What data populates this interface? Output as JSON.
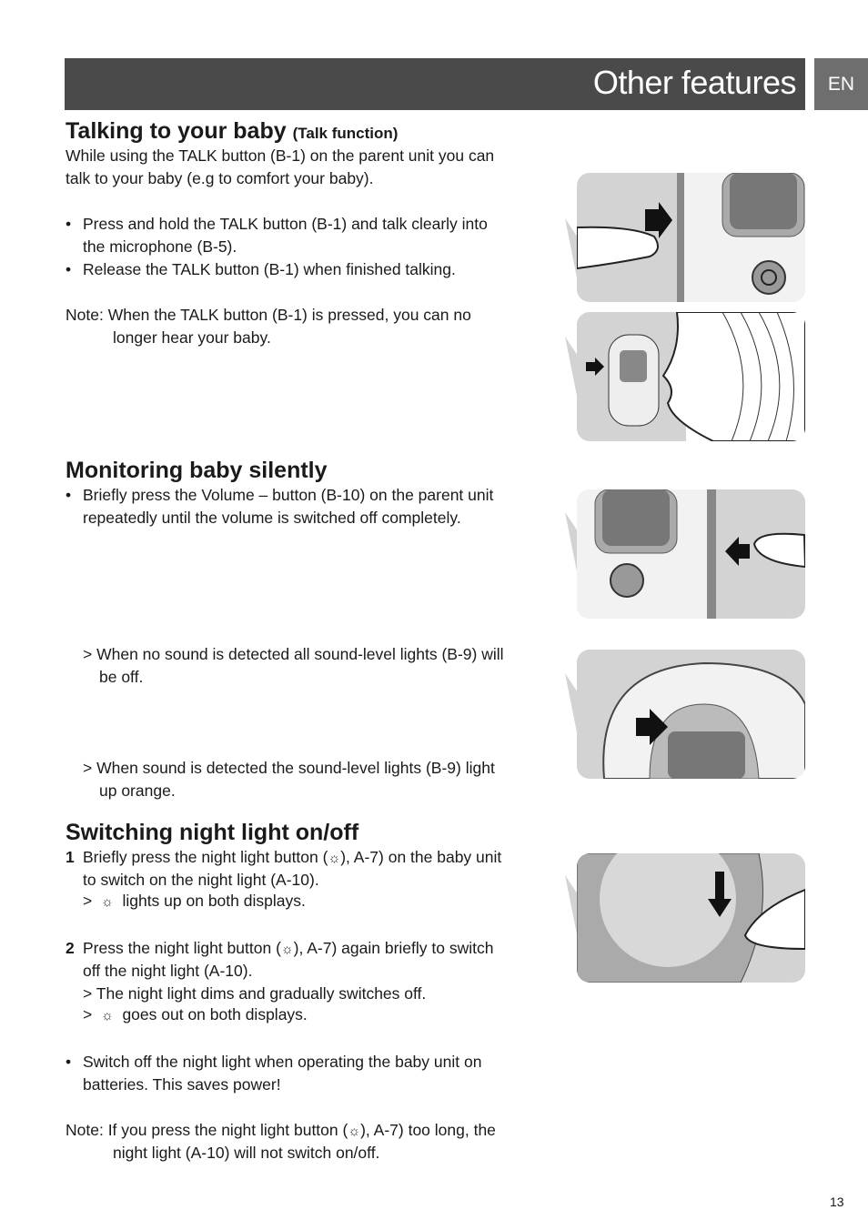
{
  "header": {
    "title": "Other features",
    "lang": "EN"
  },
  "talk": {
    "heading": "Talking to your baby",
    "heading_sub": "(Talk function)",
    "intro1": "While using the TALK button (B-1) on the parent unit you can",
    "intro2": "talk to your baby (e.g to comfort your baby).",
    "b1a": "Press and hold the TALK button (B-1) and talk clearly into",
    "b1b": "the microphone (B-5).",
    "b2": "Release the TALK button (B-1) when finished talking.",
    "note1": "Note: When the TALK button (B-1) is pressed, you can no",
    "note2": "longer hear your baby."
  },
  "monitor": {
    "heading": "Monitoring baby silently",
    "b1a": "Briefly press the Volume – button (B-10) on the parent unit",
    "b1b": "repeatedly until the volume is switched off completely.",
    "r1a": "> When no sound is detected all sound-level lights (B-9) will",
    "r1b": "be off.",
    "r2a": "> When sound is detected the sound-level lights (B-9) light",
    "r2b": "up orange."
  },
  "night": {
    "heading": "Switching night light on/off",
    "s1num": "1",
    "s1a_pre": "Briefly press the night light button (",
    "s1a_post": "), A-7) on the baby unit",
    "s1b": "to switch on the night light (A-10).",
    "s1c": "lights up on both displays.",
    "s2num": "2",
    "s2a_pre": "Press the night light button (",
    "s2a_post": "), A-7) again briefly to switch",
    "s2b": "off the night light (A-10).",
    "s2c": "> The night light dims and gradually switches off.",
    "s2d": "goes out on both displays.",
    "b1a": "Switch off the night light when operating the baby unit on",
    "b1b": "batteries. This saves power!",
    "note1_pre": "Note: If you press the night light button (",
    "note1_post": "), A-7) too long, the",
    "note2": "night light (A-10) will not switch on/off."
  },
  "icons": {
    "night_light": "sun-icon",
    "bullet": "•",
    "gt": ">"
  },
  "page_number": "13",
  "colors": {
    "header_bg": "#4a4a4a",
    "lang_bg": "#6e6e6e",
    "illustration_bg": "#d3d3d3"
  }
}
